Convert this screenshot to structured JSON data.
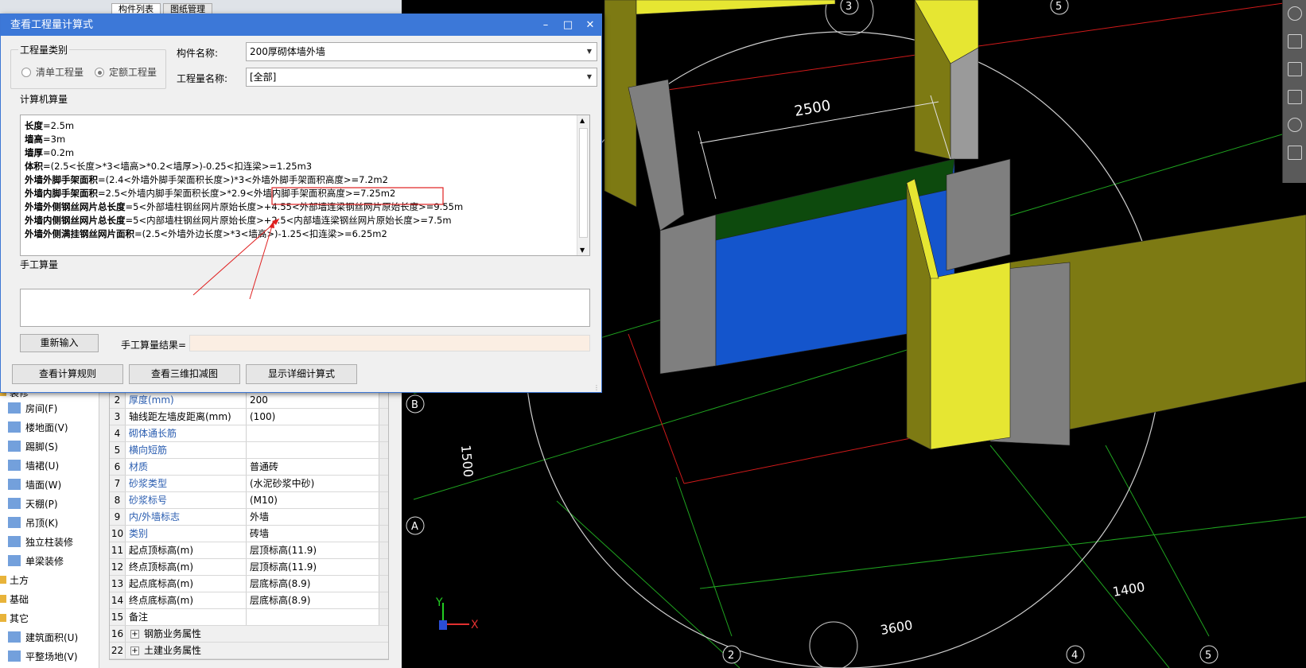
{
  "viewport": {
    "dimensions": [
      "2500",
      "1500",
      "1400",
      "3600"
    ],
    "axis_labels_numeric": [
      "3",
      "5",
      "2",
      "4",
      "5"
    ],
    "axis_labels_alpha": [
      "B",
      "A"
    ],
    "axis_indicator": {
      "y": "Y",
      "x": "X"
    },
    "colors": {
      "grid_green": "#1fa31f",
      "wall_olive": "#7d7a13",
      "wall_yellow": "#e6e632",
      "wall_grey": "#7f7f7f",
      "blue_panel": "#1455cc",
      "dark_green": "#0d4a0d",
      "red_line": "#d11a1a"
    }
  },
  "left_panel": {
    "tabs": [
      "构件列表",
      "图纸管理"
    ],
    "tree": {
      "header_partial": "装修",
      "items": [
        {
          "label": "房间(F)",
          "icon": "room-icon"
        },
        {
          "label": "楼地面(V)",
          "icon": "floor-icon"
        },
        {
          "label": "踢脚(S)",
          "icon": "skirting-icon"
        },
        {
          "label": "墙裙(U)",
          "icon": "dado-icon"
        },
        {
          "label": "墙面(W)",
          "icon": "wall-surface-icon"
        },
        {
          "label": "天棚(P)",
          "icon": "ceiling-icon"
        },
        {
          "label": "吊顶(K)",
          "icon": "suspended-ceiling-icon"
        },
        {
          "label": "独立柱装修",
          "icon": "column-finish-icon"
        },
        {
          "label": "单梁装修",
          "icon": "beam-finish-icon"
        }
      ],
      "groups": [
        "土方",
        "基础",
        "其它"
      ],
      "other_items": [
        {
          "label": "建筑面积(U)",
          "icon": "building-area-icon"
        },
        {
          "label": "平整场地(V)",
          "icon": "site-leveling-icon"
        }
      ]
    },
    "properties": {
      "rows": [
        {
          "num": "2",
          "name": "厚度(mm)",
          "value": "200",
          "blue": true
        },
        {
          "num": "3",
          "name": "轴线距左墙皮距离(mm)",
          "value": "(100)",
          "blue": false
        },
        {
          "num": "4",
          "name": "砌体通长筋",
          "value": "",
          "blue": true
        },
        {
          "num": "5",
          "name": "横向短筋",
          "value": "",
          "blue": true
        },
        {
          "num": "6",
          "name": "材质",
          "value": "普通砖",
          "blue": true
        },
        {
          "num": "7",
          "name": "砂浆类型",
          "value": "(水泥砂浆中砂)",
          "blue": true
        },
        {
          "num": "8",
          "name": "砂浆标号",
          "value": "(M10)",
          "blue": true
        },
        {
          "num": "9",
          "name": "内/外墙标志",
          "value": "外墙",
          "blue": true
        },
        {
          "num": "10",
          "name": "类别",
          "value": "砖墙",
          "blue": true
        },
        {
          "num": "11",
          "name": "起点顶标高(m)",
          "value": "层顶标高(11.9)",
          "blue": false
        },
        {
          "num": "12",
          "name": "终点顶标高(m)",
          "value": "层顶标高(11.9)",
          "blue": false
        },
        {
          "num": "13",
          "name": "起点底标高(m)",
          "value": "层底标高(8.9)",
          "blue": false
        },
        {
          "num": "14",
          "name": "终点底标高(m)",
          "value": "层底标高(8.9)",
          "blue": false
        },
        {
          "num": "15",
          "name": "备注",
          "value": "",
          "blue": false
        }
      ],
      "groups": [
        {
          "num": "16",
          "name": "钢筋业务属性"
        },
        {
          "num": "22",
          "name": "土建业务属性"
        }
      ]
    }
  },
  "dialog": {
    "title": "查看工程量计算式",
    "quantity_type": {
      "label": "工程量类别",
      "options": [
        "清单工程量",
        "定额工程量"
      ],
      "selected_index": 1
    },
    "component_name_label": "构件名称:",
    "component_name_value": "200厚砌体墙外墙",
    "quantity_name_label": "工程量名称:",
    "quantity_name_value": "[全部]",
    "computer_calc_label": "计算机算量",
    "calc_lines": [
      {
        "key": "长度",
        "expr": "=2.5m"
      },
      {
        "key": "墙高",
        "expr": "=3m"
      },
      {
        "key": "墙厚",
        "expr": "=0.2m"
      },
      {
        "key": "体积",
        "expr": "=(2.5<长度>*3<墙高>*0.2<墙厚>)-0.25<扣连梁>=1.25m3"
      },
      {
        "key": "外墙外脚手架面积",
        "expr": "=(2.4<外墙外脚手架面积长度>)*3<外墙外脚手架面积高度>=7.2m2"
      },
      {
        "key": "外墙内脚手架面积",
        "expr": "=2.5<外墙内脚手架面积长度>*2.9<外墙内脚手架面积高度>=7.25m2"
      },
      {
        "key": "外墙外侧钢丝网片总长度",
        "expr": "=5<外部墙柱钢丝网片原始长度>+4.55<外部墙连梁钢丝网片原始长度>=9.55m"
      },
      {
        "key": "外墙内侧钢丝网片总长度",
        "expr": "=5<内部墙柱钢丝网片原始长度>+2.5<内部墙连梁钢丝网片原始长度>=7.5m"
      },
      {
        "key": "外墙外侧满挂钢丝网片面积",
        "expr": "=(2.5<外墙外边长度>*3<墙高>)-1.25<扣连梁>=6.25m2"
      }
    ],
    "manual_calc_label": "手工算量",
    "reenter_button": "重新输入",
    "manual_result_label": "手工算量结果=",
    "view_rules_button": "查看计算规则",
    "view_3d_button": "查看三维扣减图",
    "show_detail_button": "显示详细计算式",
    "annotation_color": "#e02020"
  },
  "right_toolbar": {
    "icons": [
      "sphere-view-icon",
      "2d-view-icon",
      "cube-view-icon",
      "cube-corner-icon",
      "rotate-icon",
      "layers-icon"
    ]
  }
}
